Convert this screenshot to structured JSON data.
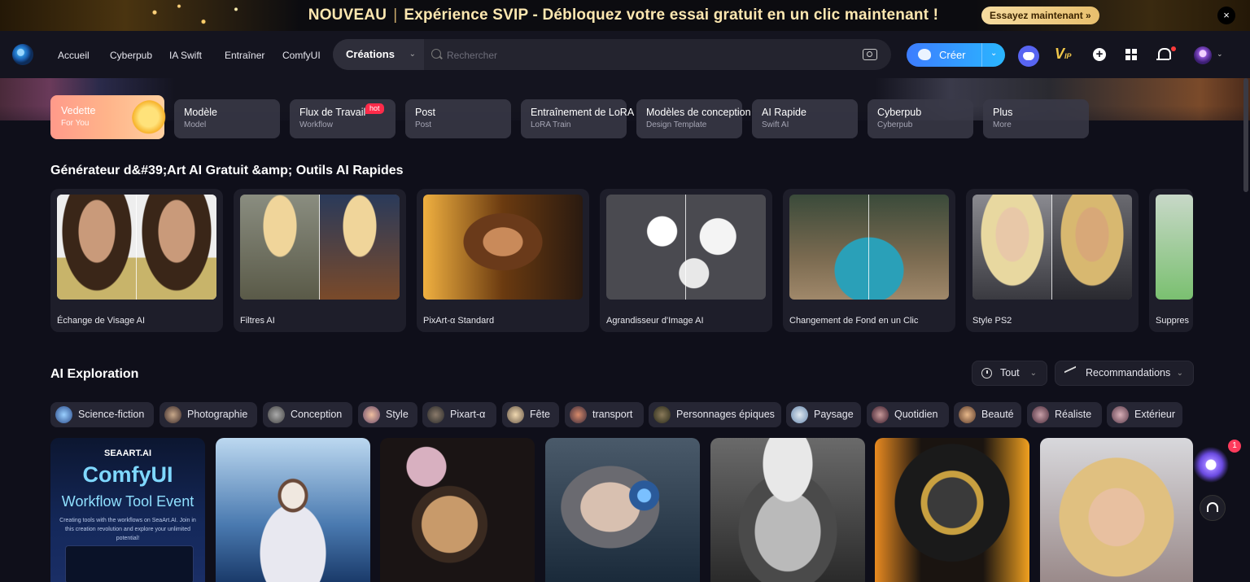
{
  "promo": {
    "new_label": "NOUVEAU",
    "message": "Expérience SVIP - Débloquez votre essai gratuit en un clic maintenant !",
    "cta": "Essayez maintenant »",
    "close": "×"
  },
  "nav": {
    "links": [
      "Accueil",
      "Cyberpub",
      "IA Swift",
      "Entraîner",
      "ComfyUI"
    ],
    "search_category": "Créations",
    "search_placeholder": "Rechercher",
    "create_label": "Créer",
    "vip_label": "V",
    "vip_sub": "IP"
  },
  "categories": [
    {
      "title": "Vedette",
      "sub": "For You"
    },
    {
      "title": "Modèle",
      "sub": "Model"
    },
    {
      "title": "Flux de Travail",
      "sub": "Workflow",
      "badge": "hot"
    },
    {
      "title": "Post",
      "sub": "Post"
    },
    {
      "title": "Entraînement de LoRA",
      "sub": "LoRA Train"
    },
    {
      "title": "Modèles de conception",
      "sub": "Design Template"
    },
    {
      "title": "AI Rapide",
      "sub": "Swift AI"
    },
    {
      "title": "Cyberpub",
      "sub": "Cyberpub"
    },
    {
      "title": "Plus",
      "sub": "More"
    }
  ],
  "tools_title": "Générateur d&#39;Art AI Gratuit &amp; Outils AI Rapides",
  "tools": [
    {
      "label": "Échange de Visage AI"
    },
    {
      "label": "Filtres AI"
    },
    {
      "label": "PixArt-α Standard"
    },
    {
      "label": "Agrandisseur d'Image AI"
    },
    {
      "label": "Changement de Fond en un Clic"
    },
    {
      "label": "Style PS2"
    },
    {
      "label": "Suppres"
    }
  ],
  "exploration": {
    "title": "AI Exploration",
    "filter_time": "Tout",
    "filter_sort": "Recommandations",
    "chips": [
      "Science-fiction",
      "Photographie",
      "Conception",
      "Style",
      "Pixart-α",
      "Fête",
      "transport",
      "Personnages épiques",
      "Paysage",
      "Quotidien",
      "Beauté",
      "Réaliste",
      "Extérieur"
    ]
  },
  "gallery_event": {
    "brand": "SEAART.AI",
    "title": "ComfyUI",
    "subtitle": "Workflow Tool Event",
    "desc": "Creating tools with the workflows on SeaArt.AI. Join in this creation revolution and explore your unlimited potential!"
  },
  "floating": {
    "badge": "1"
  },
  "colors": {
    "accent": "#2f8cff",
    "hot": "#ff2b4a",
    "vip": "#f1c84b",
    "bg": "#0f0f1a"
  }
}
